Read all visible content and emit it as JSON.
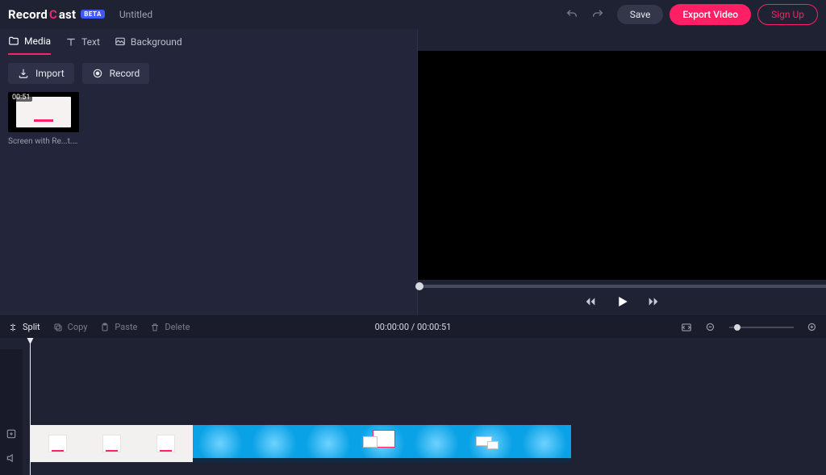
{
  "header": {
    "logo_prefix": "Record",
    "logo_accent": "C",
    "logo_suffix": "ast",
    "beta": "BETA",
    "project_title": "Untitled",
    "save": "Save",
    "export": "Export Video",
    "signup": "Sign Up"
  },
  "panel": {
    "tabs": {
      "media": "Media",
      "text": "Text",
      "background": "Background"
    },
    "import": "Import",
    "record": "Record",
    "clip": {
      "duration": "00:51",
      "name": "Screen with Re...t.webm"
    }
  },
  "toolbar": {
    "split": "Split",
    "copy": "Copy",
    "paste": "Paste",
    "delete": "Delete",
    "time": "00:00:00 / 00:00:51"
  }
}
